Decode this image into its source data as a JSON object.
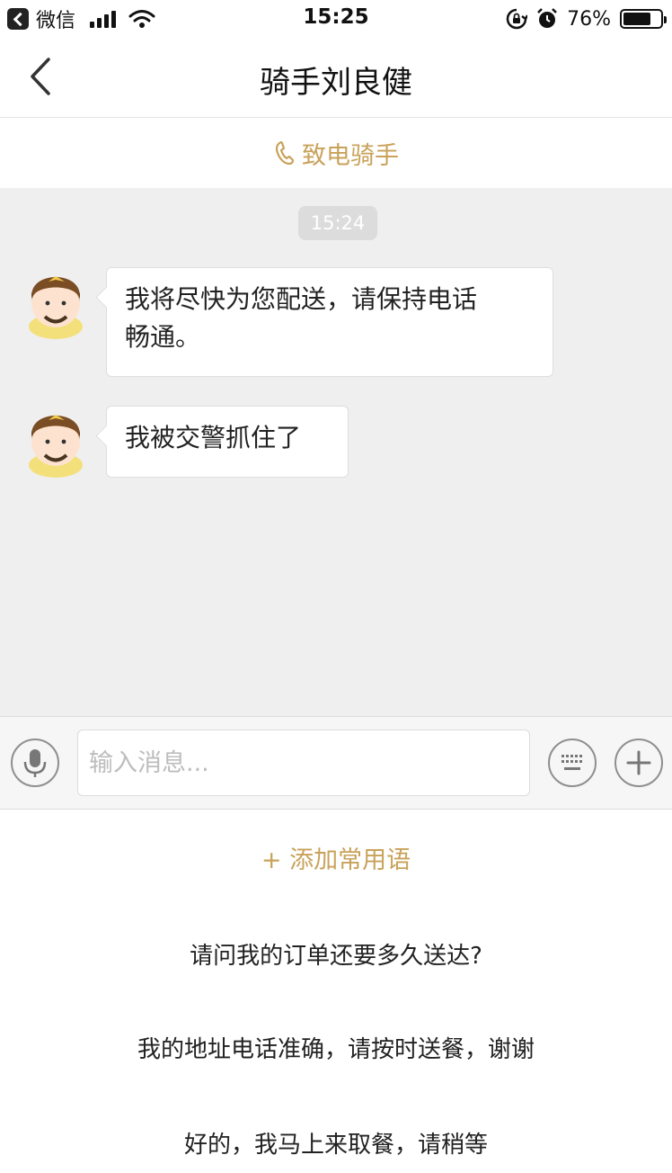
{
  "status_bar": {
    "back_app": "微信",
    "time": "15:25",
    "battery_percent": "76%",
    "battery_level": 0.76,
    "icons": [
      "back-badge-icon",
      "signal-icon",
      "wifi-icon",
      "rotation-lock-icon",
      "alarm-icon",
      "battery-icon"
    ]
  },
  "nav": {
    "title": "骑手刘良健",
    "back_icon": "chevron-left-icon"
  },
  "call": {
    "label": "致电骑手",
    "icon": "phone-icon"
  },
  "chat": {
    "timestamp": "15:24",
    "messages": [
      {
        "sender": "rider",
        "text_line1": "我将尽快为您配送，请保持电话",
        "text_line2": "畅通。"
      },
      {
        "sender": "rider",
        "text_line1": "我被交警抓住了"
      }
    ]
  },
  "input_bar": {
    "placeholder": "输入消息...",
    "icons": [
      "microphone-icon",
      "keyboard-icon",
      "plus-icon"
    ]
  },
  "phrases": {
    "add_label": "+ 添加常用语",
    "items": [
      "请问我的订单还要多久送达?",
      "我的地址电话准确，请按时送餐，谢谢",
      "好的，我马上来取餐，请稍等"
    ]
  },
  "colors": {
    "accent": "#c9a25a",
    "chat_background": "#efefef",
    "timestamp_pill": "#dcdcdc"
  }
}
